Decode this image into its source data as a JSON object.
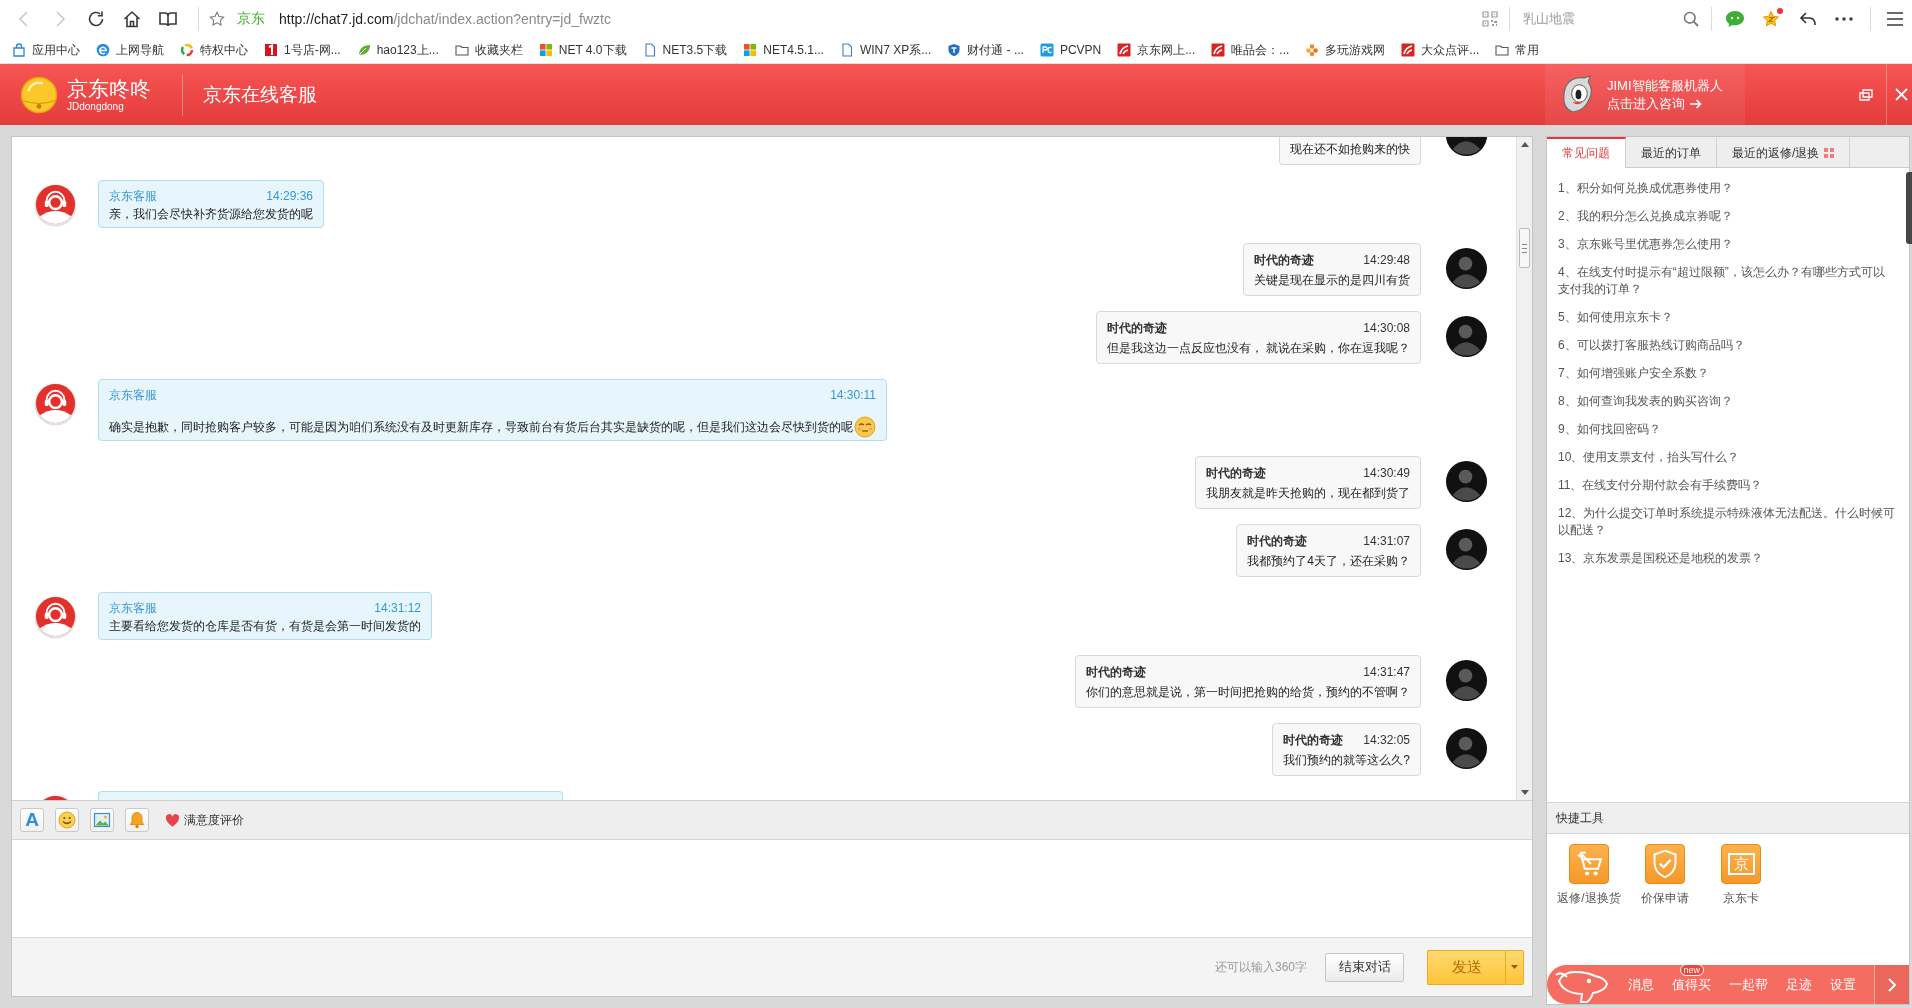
{
  "browser": {
    "back_disabled": true,
    "forward_disabled": true,
    "site_label": "京东",
    "url_host": "http://chat7.jd.com",
    "url_path": "/jdchat/index.action?entry=jd_fwztc",
    "search": {
      "placeholder": "乳山地震"
    },
    "favorites_notification": true
  },
  "bookmarks": [
    {
      "label": "应用中心",
      "kind": "link"
    },
    {
      "label": "上网导航",
      "kind": "link"
    },
    {
      "label": "特权中心",
      "kind": "link"
    },
    {
      "label": "1号店-网...",
      "kind": "link"
    },
    {
      "label": "hao123上...",
      "kind": "link"
    },
    {
      "label": "收藏夹栏",
      "kind": "folder"
    },
    {
      "label": "NET 4.0下载",
      "kind": "link"
    },
    {
      "label": "NET3.5下载",
      "kind": "page"
    },
    {
      "label": "NET4.5.1...",
      "kind": "link"
    },
    {
      "label": "WIN7 XP系...",
      "kind": "page"
    },
    {
      "label": "财付通 - ...",
      "kind": "link"
    },
    {
      "label": "PCVPN",
      "kind": "link"
    },
    {
      "label": "京东网上...",
      "kind": "link"
    },
    {
      "label": "唯品会：...",
      "kind": "link"
    },
    {
      "label": "多玩游戏网",
      "kind": "link"
    },
    {
      "label": "大众点评...",
      "kind": "link"
    },
    {
      "label": "常用",
      "kind": "folder"
    }
  ],
  "header": {
    "app_name": "京东咚咚",
    "app_subtitle": "JDdongdong",
    "title": "京东在线客服",
    "robot_title": "JIMI智能客服机器人",
    "robot_link": "点击进入咨询"
  },
  "chat": {
    "messages": [
      {
        "kind": "user",
        "clipped_top": true,
        "text": "现在还不如抢购来的快"
      },
      {
        "kind": "agent",
        "name": "京东客服",
        "time": "14:29:36",
        "text": "亲，我们会尽快补齐货源给您发货的呢"
      },
      {
        "kind": "user",
        "name": "时代的奇迹",
        "time": "14:29:48",
        "text": "关键是现在显示的是四川有货"
      },
      {
        "kind": "user",
        "name": "时代的奇迹",
        "time": "14:30:08",
        "text": "但是我这边一点反应也没有， 就说在采购，你在逗我呢？"
      },
      {
        "kind": "agent",
        "name": "京东客服",
        "time": "14:30:11",
        "text": "确实是抱歉，同时抢购客户较多，可能是因为咱们系统没有及时更新库存，导致前台有货后台其实是缺货的呢，但是我们这边会尽快到货的呢",
        "emoticon": true
      },
      {
        "kind": "user",
        "name": "时代的奇迹",
        "time": "14:30:49",
        "text": "我朋友就是昨天抢购的，现在都到货了"
      },
      {
        "kind": "user",
        "name": "时代的奇迹",
        "time": "14:31:07",
        "text": "我都预约了4天了，还在采购？"
      },
      {
        "kind": "agent",
        "name": "京东客服",
        "time": "14:31:12",
        "text": "主要看给您发货的仓库是否有货，有货是会第一时间发货的"
      },
      {
        "kind": "user",
        "name": "时代的奇迹",
        "time": "14:31:47",
        "text": "你们的意思就是说，第一时间把抢购的给货，预约的不管啊？"
      },
      {
        "kind": "user",
        "name": "时代的奇迹",
        "time": "14:32:05",
        "text": "我们预约的就等这么久?"
      },
      {
        "kind": "agent",
        "clipped_bottom": true
      }
    ],
    "toolbar": {
      "font_glyph": "A",
      "rating_label": "满意度评价"
    },
    "remaining": "还可以输入360字",
    "end_button": "结束对话",
    "send_button": "发送"
  },
  "sidebar": {
    "tabs": [
      {
        "label": "常见问题",
        "selected": true
      },
      {
        "label": "最近的订单",
        "selected": false
      },
      {
        "label": "最近的返修/退换",
        "selected": false,
        "menu": true
      }
    ],
    "faq": [
      "1、积分如何兑换成优惠券使用？",
      "2、我的积分怎么兑换成京券呢？",
      "3、京东账号里优惠券怎么使用？",
      "4、在线支付时提示有“超过限额”，该怎么办？有哪些方式可以支付我的订单？",
      "5、如何使用京东卡？",
      "6、可以拨打客服热线订购商品吗？",
      "7、如何增强账户安全系数？",
      "8、如何查询我发表的购买咨询？",
      "9、如何找回密码？",
      "10、使用支票支付，抬头写什么？",
      "11、在线支付分期付款会有手续费吗？",
      "12、为什么提交订单时系统提示特殊液体无法配送。什么时候可以配送？",
      "13、京东发票是国税还是地税的发票？"
    ],
    "tools_title": "快捷工具",
    "tools": [
      {
        "label": "返修/退换货"
      },
      {
        "label": "价保申请"
      },
      {
        "label": "京东卡",
        "glyph": "京"
      }
    ],
    "dock": [
      {
        "label": "消息"
      },
      {
        "label": "值得买",
        "badge": "new"
      },
      {
        "label": "一起帮"
      },
      {
        "label": "足迹"
      },
      {
        "label": "设置"
      }
    ]
  }
}
